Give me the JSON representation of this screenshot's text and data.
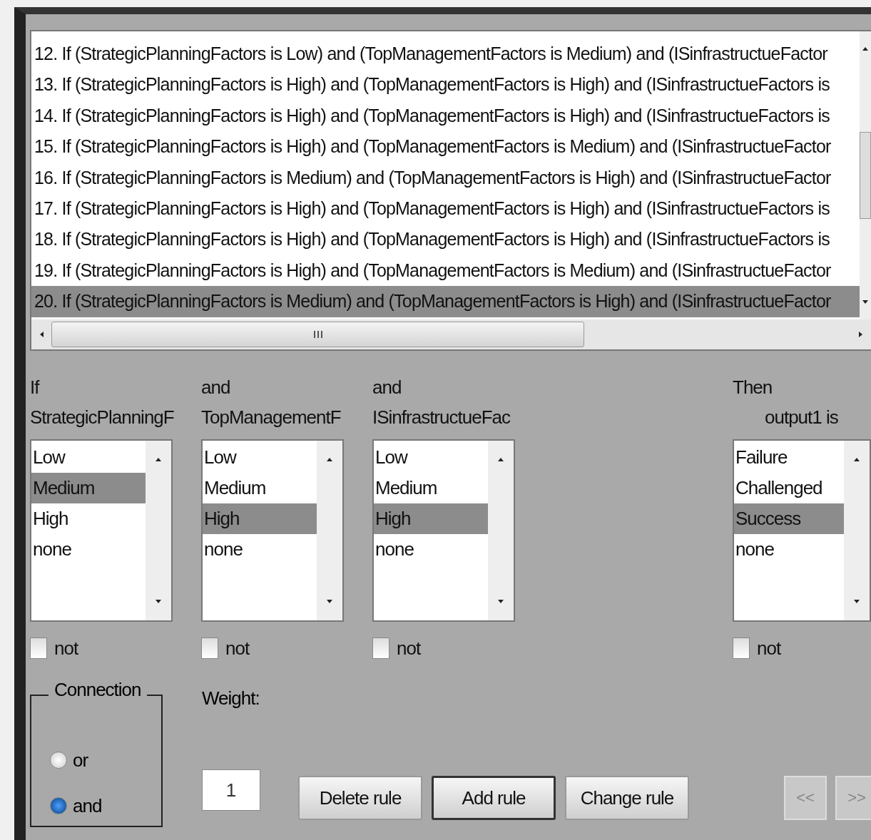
{
  "rules": [
    {
      "text": "12. If (StrategicPlanningFactors is Low) and (TopManagementFactors is Medium) and (ISinfrastructueFactor",
      "selected": false
    },
    {
      "text": "13. If (StrategicPlanningFactors is High) and (TopManagementFactors is High) and (ISinfrastructueFactors is",
      "selected": false
    },
    {
      "text": "14. If (StrategicPlanningFactors is High) and (TopManagementFactors is High) and (ISinfrastructueFactors is",
      "selected": false
    },
    {
      "text": "15. If (StrategicPlanningFactors is High) and (TopManagementFactors is Medium) and (ISinfrastructueFactor",
      "selected": false
    },
    {
      "text": "16. If (StrategicPlanningFactors is Medium) and (TopManagementFactors is High) and (ISinfrastructueFactor",
      "selected": false
    },
    {
      "text": "17. If (StrategicPlanningFactors is High) and (TopManagementFactors is High) and (ISinfrastructueFactors is",
      "selected": false
    },
    {
      "text": "18. If (StrategicPlanningFactors is High) and (TopManagementFactors is High) and (ISinfrastructueFactors is",
      "selected": false
    },
    {
      "text": "19. If (StrategicPlanningFactors is High) and (TopManagementFactors is Medium) and (ISinfrastructueFactor",
      "selected": false
    },
    {
      "text": "20. If (StrategicPlanningFactors is Medium) and (TopManagementFactors is High) and (ISinfrastructueFactor",
      "selected": true
    }
  ],
  "columns": [
    {
      "kind": "antecedent",
      "connective": "If",
      "variable": "StrategicPlanningF",
      "not_label": "not",
      "not": false,
      "options": [
        {
          "label": "Low",
          "selected": false
        },
        {
          "label": "Medium",
          "selected": true
        },
        {
          "label": "High",
          "selected": false
        },
        {
          "label": "none",
          "selected": false
        }
      ]
    },
    {
      "kind": "antecedent",
      "connective": "and",
      "variable": "TopManagementF",
      "not_label": "not",
      "not": false,
      "options": [
        {
          "label": "Low",
          "selected": false
        },
        {
          "label": "Medium",
          "selected": false
        },
        {
          "label": "High",
          "selected": true
        },
        {
          "label": "none",
          "selected": false
        }
      ]
    },
    {
      "kind": "antecedent",
      "connective": "and",
      "variable": "ISinfrastructueFac",
      "not_label": "not",
      "not": false,
      "options": [
        {
          "label": "Low",
          "selected": false
        },
        {
          "label": "Medium",
          "selected": false
        },
        {
          "label": "High",
          "selected": true
        },
        {
          "label": "none",
          "selected": false
        }
      ]
    },
    {
      "kind": "consequent",
      "connective": "Then",
      "variable": "output1 is",
      "not_label": "not",
      "not": false,
      "options": [
        {
          "label": "Failure",
          "selected": false
        },
        {
          "label": "Challenged",
          "selected": false
        },
        {
          "label": "Success",
          "selected": true
        },
        {
          "label": "none",
          "selected": false
        }
      ]
    }
  ],
  "connection": {
    "title": "Connection",
    "options": [
      {
        "label": "or",
        "selected": false
      },
      {
        "label": "and",
        "selected": true
      }
    ]
  },
  "weight": {
    "label": "Weight:",
    "value": "1"
  },
  "buttons": [
    {
      "label": "Delete rule",
      "focused": false
    },
    {
      "label": "Add rule",
      "focused": true
    },
    {
      "label": "Change rule",
      "focused": false
    }
  ],
  "nav_buttons": [
    {
      "label": "<<",
      "disabled": true
    },
    {
      "label": ">>",
      "disabled": true
    }
  ]
}
